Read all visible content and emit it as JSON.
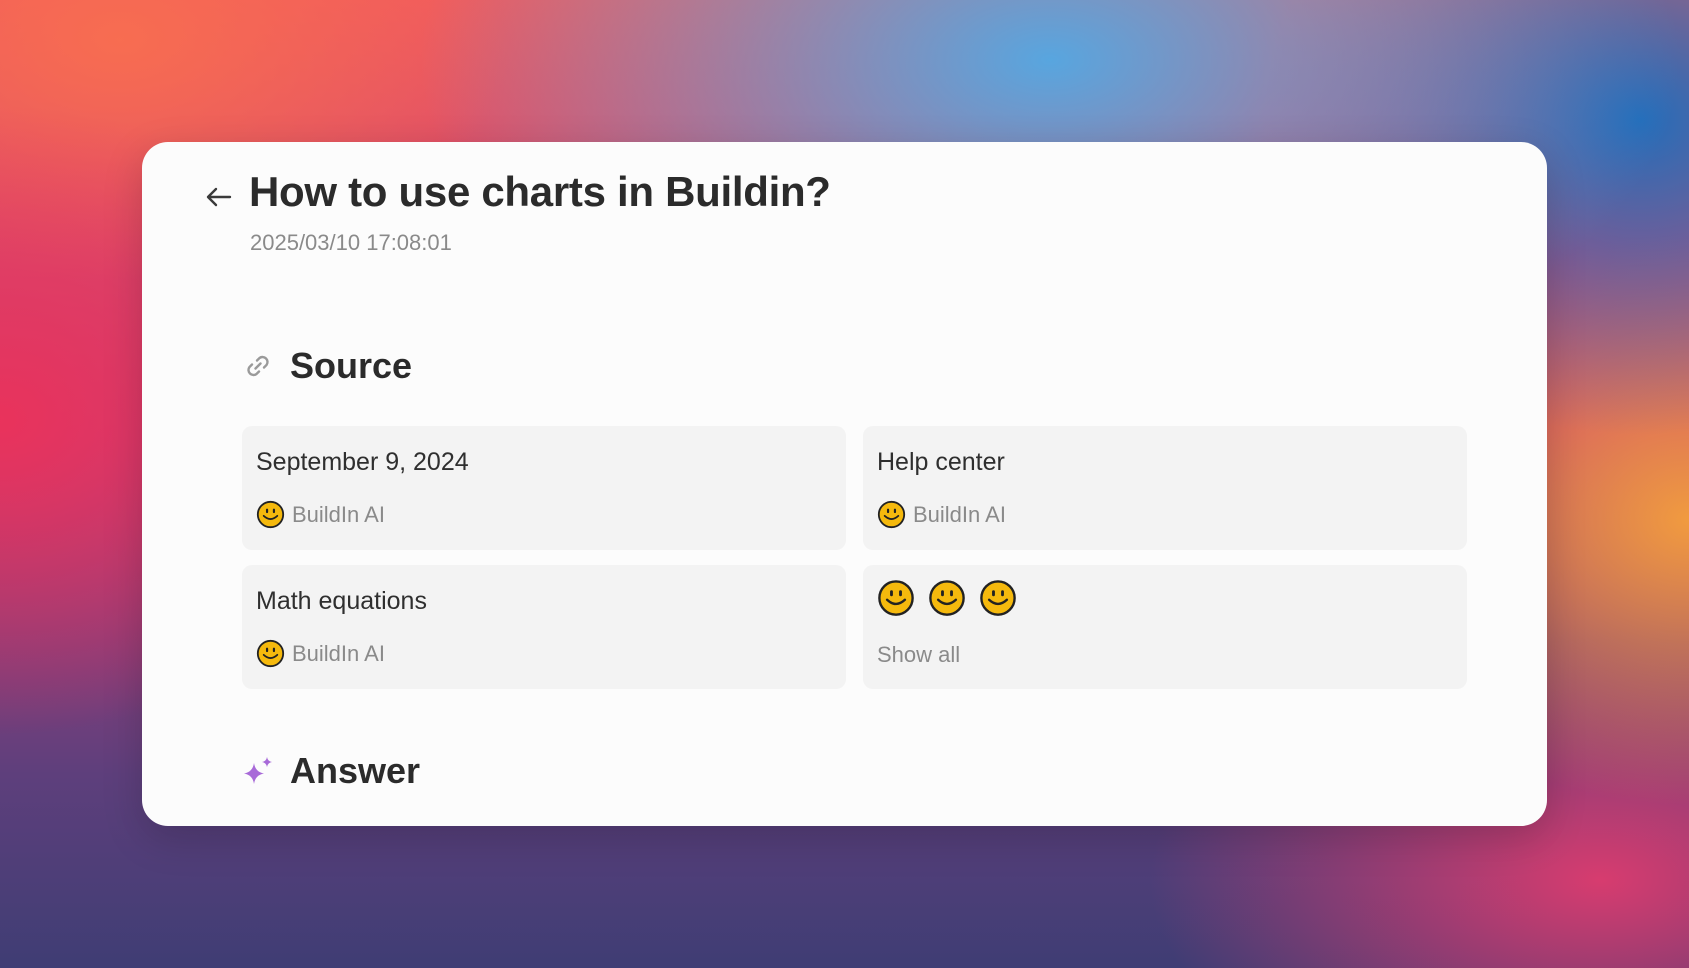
{
  "page": {
    "title": "How to use charts in Buildin?",
    "timestamp": "2025/03/10 17:08:01"
  },
  "source_section": {
    "heading": "Source",
    "icon": "link-icon",
    "cards": [
      {
        "title": "September 9, 2024",
        "author": "BuildIn AI",
        "icon": "smiley-icon"
      },
      {
        "title": "Help center",
        "author": "BuildIn AI",
        "icon": "smiley-icon"
      },
      {
        "title": "Math equations",
        "author": "BuildIn AI",
        "icon": "smiley-icon"
      }
    ],
    "more_card": {
      "icons": [
        "smiley-icon",
        "smiley-icon",
        "smiley-icon"
      ],
      "label": "Show all"
    }
  },
  "answer_section": {
    "heading": "Answer",
    "icon": "sparkle-icon"
  },
  "colors": {
    "card_background": "#fcfcfc",
    "source_card_background": "#f3f3f3",
    "sparkle": "#a86ad8",
    "emoji_face": "#f5b90d"
  }
}
